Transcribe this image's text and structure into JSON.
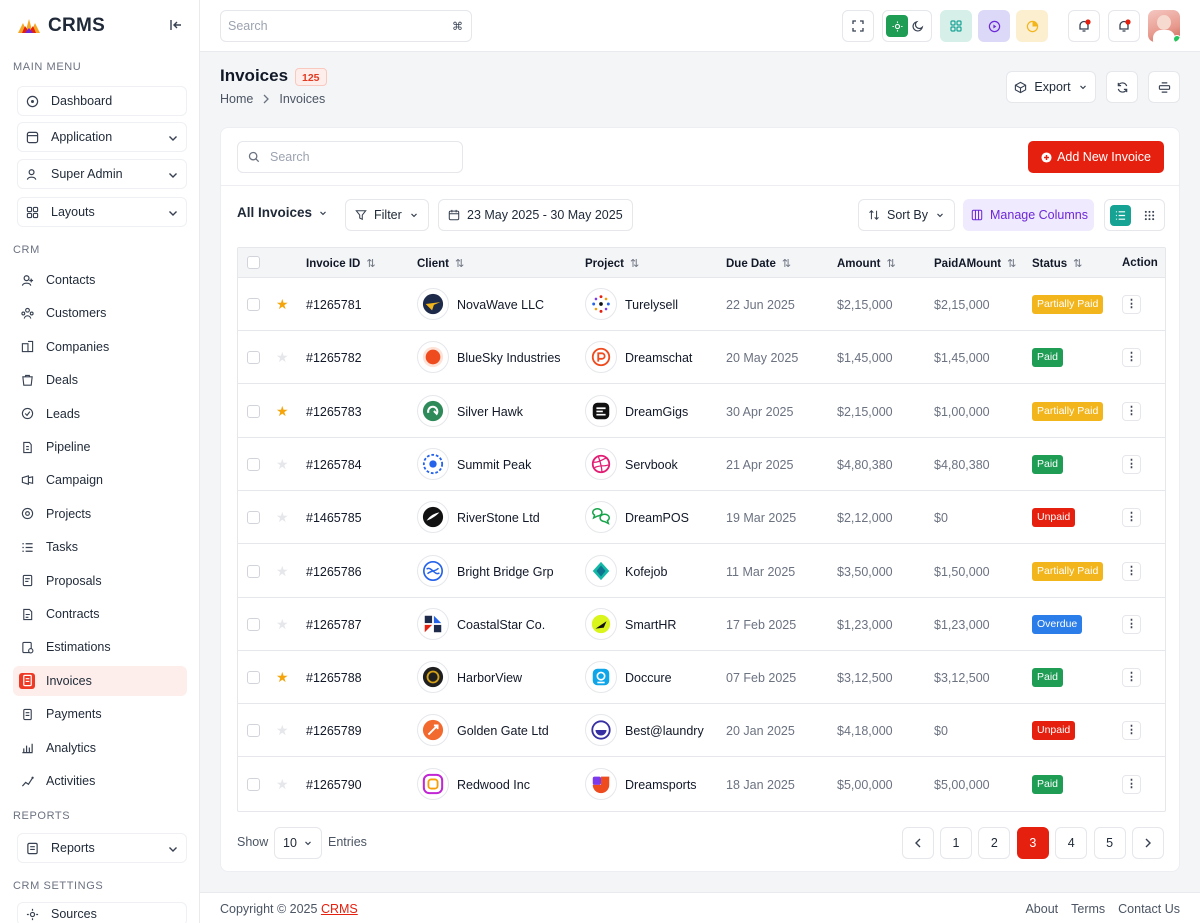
{
  "app": {
    "name": "CRMS"
  },
  "sidebar": {
    "main_menu_title": "MAIN MENU",
    "main_items": [
      {
        "label": "Dashboard",
        "icon": "dashboard-icon"
      },
      {
        "label": "Application",
        "icon": "application-icon"
      },
      {
        "label": "Super Admin",
        "icon": "super-admin-icon"
      },
      {
        "label": "Layouts",
        "icon": "layouts-icon"
      }
    ],
    "crm_title": "CRM",
    "crm_items": [
      {
        "label": "Contacts",
        "icon": "contacts-icon"
      },
      {
        "label": "Customers",
        "icon": "customers-icon"
      },
      {
        "label": "Companies",
        "icon": "companies-icon"
      },
      {
        "label": "Deals",
        "icon": "deals-icon"
      },
      {
        "label": "Leads",
        "icon": "leads-icon"
      },
      {
        "label": "Pipeline",
        "icon": "pipeline-icon"
      },
      {
        "label": "Campaign",
        "icon": "campaign-icon"
      },
      {
        "label": "Projects",
        "icon": "projects-icon"
      },
      {
        "label": "Tasks",
        "icon": "tasks-icon"
      },
      {
        "label": "Proposals",
        "icon": "proposals-icon"
      },
      {
        "label": "Contracts",
        "icon": "contracts-icon"
      },
      {
        "label": "Estimations",
        "icon": "estimations-icon"
      },
      {
        "label": "Invoices",
        "icon": "invoices-icon",
        "active": true
      },
      {
        "label": "Payments",
        "icon": "payments-icon"
      },
      {
        "label": "Analytics",
        "icon": "analytics-icon"
      },
      {
        "label": "Activities",
        "icon": "activities-icon"
      }
    ],
    "reports_title": "REPORTS",
    "reports_item": "Reports",
    "settings_title": "CRM SETTINGS",
    "settings_item": "Sources"
  },
  "topbar": {
    "search_placeholder": "Search",
    "shortcut": "⌘"
  },
  "page": {
    "title": "Invoices",
    "count": "125",
    "breadcrumb": [
      "Home",
      "Invoices"
    ],
    "export_label": "Export"
  },
  "toolbar": {
    "search_placeholder": "Search",
    "add_label": "Add New Invoice",
    "all_label": "All Invoices",
    "filter_label": "Filter",
    "date_range": "23 May 2025 - 30 May 2025",
    "sort_label": "Sort By",
    "manage_label": "Manage Columns"
  },
  "table": {
    "headers": [
      "Invoice ID",
      "Client",
      "Project",
      "Due Date",
      "Amount",
      "PaidAMount",
      "Status",
      "Action"
    ],
    "rows": [
      {
        "id": "#1265781",
        "starred": true,
        "client": "NovaWave LLC",
        "project": "Turelysell",
        "due": "22 Jun 2025",
        "amount": "$2,15,000",
        "paid": "$2,15,000",
        "status": "Partially Paid"
      },
      {
        "id": "#1265782",
        "starred": false,
        "client": "BlueSky Industries",
        "project": "Dreamschat",
        "due": "20 May 2025",
        "amount": "$1,45,000",
        "paid": "$1,45,000",
        "status": "Paid"
      },
      {
        "id": "#1265783",
        "starred": true,
        "client": "Silver Hawk",
        "project": "DreamGigs",
        "due": "30 Apr 2025",
        "amount": "$2,15,000",
        "paid": "$1,00,000",
        "status": "Partially Paid"
      },
      {
        "id": "#1265784",
        "starred": false,
        "client": "Summit  Peak",
        "project": "Servbook",
        "due": "21 Apr 2025",
        "amount": "$4,80,380",
        "paid": "$4,80,380",
        "status": "Paid"
      },
      {
        "id": "#1465785",
        "starred": false,
        "client": "RiverStone Ltd",
        "project": "DreamPOS",
        "due": "19 Mar 2025",
        "amount": "$2,12,000",
        "paid": "$0",
        "status": "Unpaid"
      },
      {
        "id": "#1265786",
        "starred": false,
        "client": "Bright Bridge Grp",
        "project": "Kofejob",
        "due": "11 Mar 2025",
        "amount": "$3,50,000",
        "paid": "$1,50,000",
        "status": "Partially Paid"
      },
      {
        "id": "#1265787",
        "starred": false,
        "client": "CoastalStar Co.",
        "project": "SmartHR",
        "due": "17 Feb 2025",
        "amount": "$1,23,000",
        "paid": "$1,23,000",
        "status": "Overdue"
      },
      {
        "id": "#1265788",
        "starred": true,
        "client": "HarborView",
        "project": "Doccure",
        "due": "07 Feb 2025",
        "amount": "$3,12,500",
        "paid": "$3,12,500",
        "status": "Paid"
      },
      {
        "id": "#1265789",
        "starred": false,
        "client": "Golden Gate Ltd",
        "project": "Best@laundry",
        "due": "20 Jan 2025",
        "amount": "$4,18,000",
        "paid": "$0",
        "status": "Unpaid"
      },
      {
        "id": "#1265790",
        "starred": false,
        "client": "Redwood Inc",
        "project": "Dreamsports",
        "due": "18 Jan 2025",
        "amount": "$5,00,000",
        "paid": "$5,00,000",
        "status": "Paid"
      }
    ]
  },
  "status_colors": {
    "Partially Paid": "#f2b51c",
    "Paid": "#1f9d55",
    "Unpaid": "#e5200e",
    "Overdue": "#2b7de9"
  },
  "pagination": {
    "show_label": "Show",
    "entries_value": "10",
    "entries_label": "Entries",
    "pages": [
      "1",
      "2",
      "3",
      "4",
      "5"
    ],
    "current": "3"
  },
  "footer": {
    "copyright": "Copyright © 2025",
    "brand": "CRMS",
    "links": [
      "About",
      "Terms",
      "Contact Us"
    ]
  },
  "colors": {
    "accent": "#e5200e",
    "teal": "#16a394",
    "purple": "#6d28d9"
  }
}
